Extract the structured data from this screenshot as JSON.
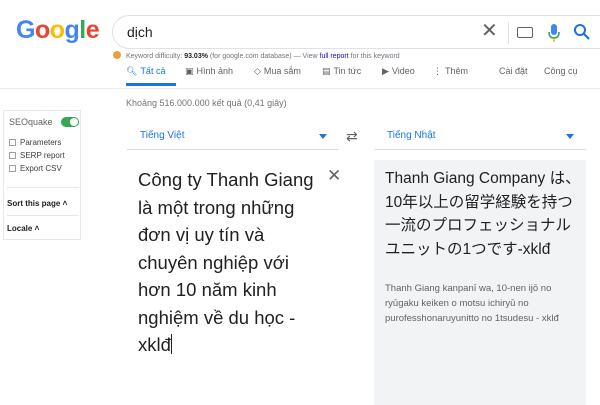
{
  "logo": {
    "text": "Google"
  },
  "search": {
    "query": "dịch",
    "icons": [
      "close-icon",
      "keyboard-icon",
      "mic-icon",
      "search-icon"
    ]
  },
  "seoquake_bar": {
    "kd_label": "Keyword difficulty:",
    "kd_value": "93.03%",
    "kd_note": "(for google.com database)",
    "dash": "—",
    "view_text": "View",
    "report_link": "full report",
    "report_suffix": "for this keyword"
  },
  "tabs": [
    {
      "label": "Tất cả",
      "icon": "search-icon",
      "active": true
    },
    {
      "label": "Hình ảnh",
      "icon": "image-icon"
    },
    {
      "label": "Mua sắm",
      "icon": "tag-icon"
    },
    {
      "label": "Tin tức",
      "icon": "news-icon"
    },
    {
      "label": "Video",
      "icon": "video-icon"
    },
    {
      "label": "Thêm",
      "icon": "more-icon"
    }
  ],
  "tools": {
    "settings": "Cài đặt",
    "tools": "Công cụ"
  },
  "stats": "Khoảng 516.000.000 kết quả (0,41 giây)",
  "seoquake": {
    "title": "SEOquake",
    "items": [
      "Parameters",
      "SERP report",
      "Export CSV"
    ],
    "sort": "Sort this page",
    "locale": "Locale"
  },
  "translator": {
    "source_lang": "Tiếng Việt",
    "target_lang": "Tiếng Nhật",
    "source_text": "Công ty Thanh Giang là một trong những đơn vị uy tín và chuyên nghiệp với hơn 10 năm kinh nghiệm về du học - xklđ",
    "target_text": "Thanh Giang Company は、10年以上の留学経験を持つ一流のプロフェッショナルユニットの1つです-xklđ",
    "romanization": "Thanh Giang kanpanī wa, 10-nen ijō no ryūgaku keiken o motsu ichiryū no purofesshonaruyunitto no 1tsudesu - xklđ"
  },
  "colors": {
    "accent": "#1a73e8",
    "link": "#1a0dab",
    "toggle": "#34a853"
  }
}
